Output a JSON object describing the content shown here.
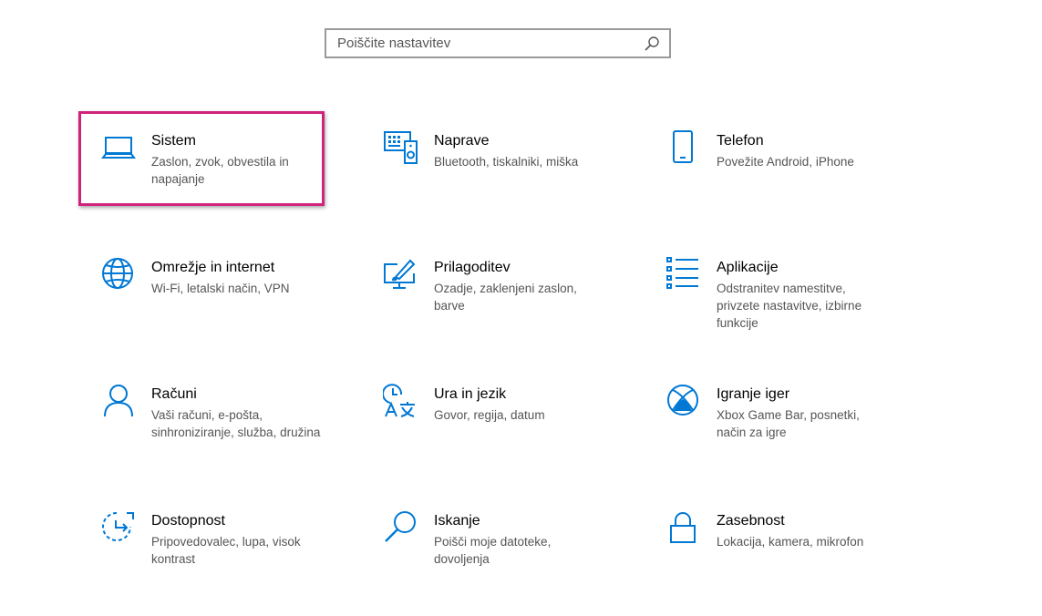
{
  "search": {
    "placeholder": "Poiščite nastavitev"
  },
  "colors": {
    "accent": "#0078d4",
    "highlight": "#d0237c"
  },
  "tiles": [
    {
      "title": "Sistem",
      "desc": "Zaslon, zvok, obvestila in napajanje",
      "icon": "laptop-icon"
    },
    {
      "title": "Naprave",
      "desc": "Bluetooth, tiskalniki, miška",
      "icon": "devices-icon"
    },
    {
      "title": "Telefon",
      "desc": "Povežite Android, iPhone",
      "icon": "phone-icon"
    },
    {
      "title": "Omrežje in internet",
      "desc": "Wi-Fi, letalski način, VPN",
      "icon": "globe-icon"
    },
    {
      "title": "Prilagoditev",
      "desc": "Ozadje, zaklenjeni zaslon, barve",
      "icon": "personalization-icon"
    },
    {
      "title": "Aplikacije",
      "desc": "Odstranitev namestitve, privzete nastavitve, izbirne funkcije",
      "icon": "apps-list-icon"
    },
    {
      "title": "Računi",
      "desc": "Vaši računi, e-pošta, sinhroniziranje, služba, družina",
      "icon": "person-icon"
    },
    {
      "title": "Ura in jezik",
      "desc": "Govor, regija, datum",
      "icon": "time-language-icon"
    },
    {
      "title": "Igranje iger",
      "desc": "Xbox Game Bar, posnetki, način za igre",
      "icon": "xbox-icon"
    },
    {
      "title": "Dostopnost",
      "desc": "Pripovedovalec, lupa, visok kontrast",
      "icon": "accessibility-icon"
    },
    {
      "title": "Iskanje",
      "desc": "Poišči moje datoteke, dovoljenja",
      "icon": "search-icon"
    },
    {
      "title": "Zasebnost",
      "desc": "Lokacija, kamera, mikrofon",
      "icon": "lock-icon"
    }
  ]
}
